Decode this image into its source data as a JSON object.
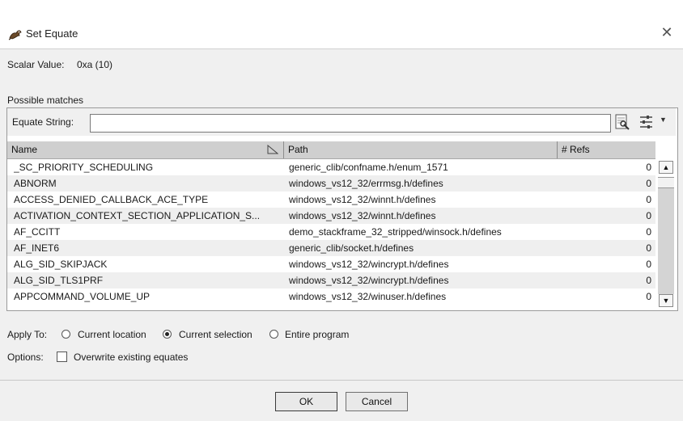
{
  "window": {
    "title": "Set Equate",
    "close_symbol": "✕"
  },
  "scalar": {
    "label": "Scalar Value:",
    "value": "0xa (10)"
  },
  "matches": {
    "label": "Possible matches"
  },
  "filter": {
    "label": "Equate String:",
    "value": "",
    "placeholder": ""
  },
  "table": {
    "columns": [
      "Name",
      "Path",
      "# Refs"
    ],
    "rows": [
      {
        "name": "_SC_PRIORITY_SCHEDULING",
        "path": "generic_clib/confname.h/enum_1571",
        "refs": "0"
      },
      {
        "name": "ABNORM",
        "path": "windows_vs12_32/errmsg.h/defines",
        "refs": "0"
      },
      {
        "name": "ACCESS_DENIED_CALLBACK_ACE_TYPE",
        "path": "windows_vs12_32/winnt.h/defines",
        "refs": "0"
      },
      {
        "name": "ACTIVATION_CONTEXT_SECTION_APPLICATION_S...",
        "path": "windows_vs12_32/winnt.h/defines",
        "refs": "0"
      },
      {
        "name": "AF_CCITT",
        "path": "demo_stackframe_32_stripped/winsock.h/defines",
        "refs": "0"
      },
      {
        "name": "AF_INET6",
        "path": "generic_clib/socket.h/defines",
        "refs": "0"
      },
      {
        "name": "ALG_SID_SKIPJACK",
        "path": "windows_vs12_32/wincrypt.h/defines",
        "refs": "0"
      },
      {
        "name": "ALG_SID_TLS1PRF",
        "path": "windows_vs12_32/wincrypt.h/defines",
        "refs": "0"
      },
      {
        "name": "APPCOMMAND_VOLUME_UP",
        "path": "windows_vs12_32/winuser.h/defines",
        "refs": "0"
      }
    ]
  },
  "apply_to": {
    "label": "Apply To:",
    "options": [
      "Current location",
      "Current selection",
      "Entire program"
    ],
    "selected": "Current selection"
  },
  "options": {
    "label": "Options:",
    "overwrite_label": "Overwrite existing equates",
    "overwrite_checked": false
  },
  "buttons": {
    "ok": "OK",
    "cancel": "Cancel"
  },
  "colors": {
    "dialog_bg": "#f0f0f0",
    "header_bg": "#cfcfcf",
    "row_alt": "#efefef"
  }
}
